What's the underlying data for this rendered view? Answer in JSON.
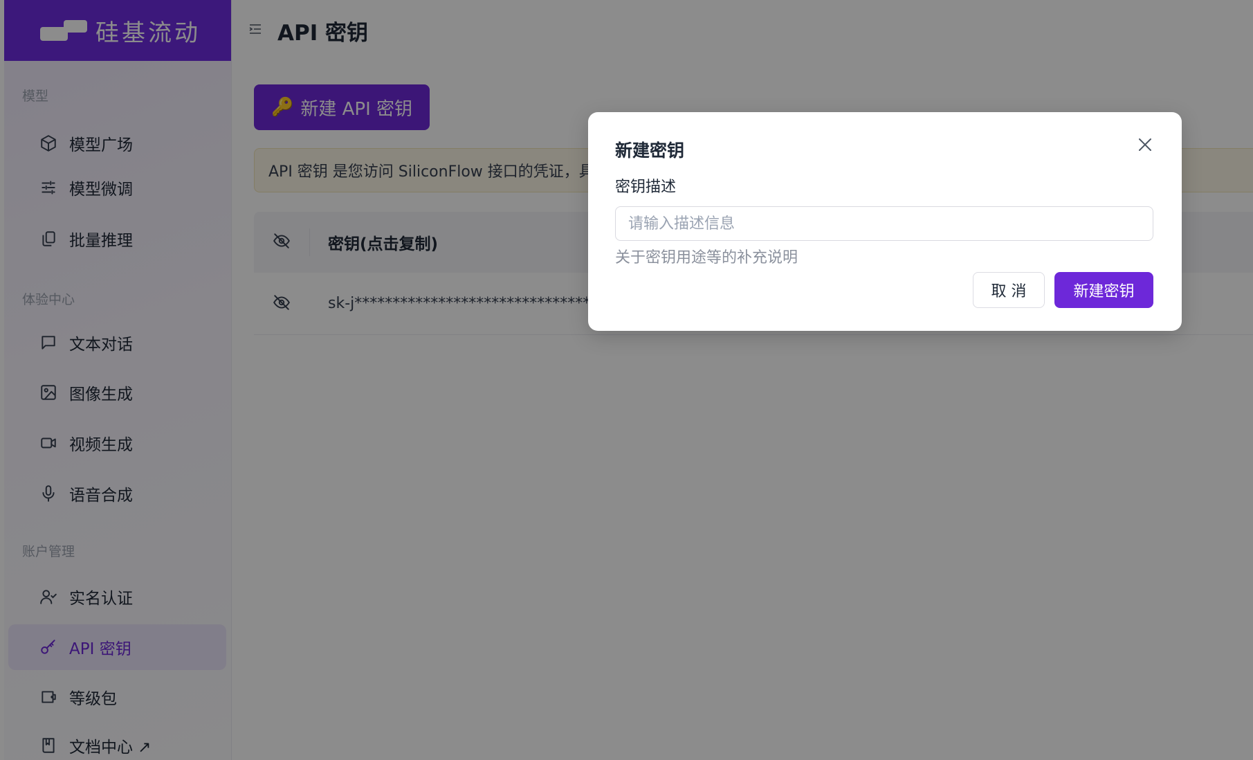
{
  "brand": {
    "name": "硅基流动"
  },
  "header": {
    "title": "API 密钥"
  },
  "sidebar": {
    "sections": [
      {
        "title": "模型",
        "items": [
          {
            "label": "模型广场",
            "icon": "cube-icon"
          },
          {
            "label": "模型微调",
            "icon": "sliders-icon"
          },
          {
            "label": "批量推理",
            "icon": "copy-icon"
          }
        ]
      },
      {
        "title": "体验中心",
        "items": [
          {
            "label": "文本对话",
            "icon": "chat-icon"
          },
          {
            "label": "图像生成",
            "icon": "image-icon"
          },
          {
            "label": "视频生成",
            "icon": "video-icon"
          },
          {
            "label": "语音合成",
            "icon": "mic-icon"
          }
        ]
      },
      {
        "title": "账户管理",
        "items": [
          {
            "label": "实名认证",
            "icon": "user-check-icon"
          },
          {
            "label": "API 密钥",
            "icon": "key-icon",
            "active": true
          },
          {
            "label": "等级包",
            "icon": "wallet-icon"
          },
          {
            "label": "文档中心 ↗",
            "icon": "book-icon"
          }
        ]
      }
    ]
  },
  "main": {
    "new_key_button": "新建 API 密钥",
    "notice": "API 密钥 是您访问 SiliconFlow 接口的凭证，具",
    "table": {
      "header": "密钥(点击复制)",
      "rows": [
        {
          "key": "sk-j************************************"
        }
      ]
    }
  },
  "modal": {
    "title": "新建密钥",
    "field_label": "密钥描述",
    "input_value": "",
    "input_placeholder": "请输入描述信息",
    "help": "关于密钥用途等的补充说明",
    "cancel": "取 消",
    "confirm": "新建密钥"
  },
  "colors": {
    "accent": "#6d28d9",
    "logo_bg": "#6e2ce0",
    "notice_bg": "#fbf6e6"
  }
}
